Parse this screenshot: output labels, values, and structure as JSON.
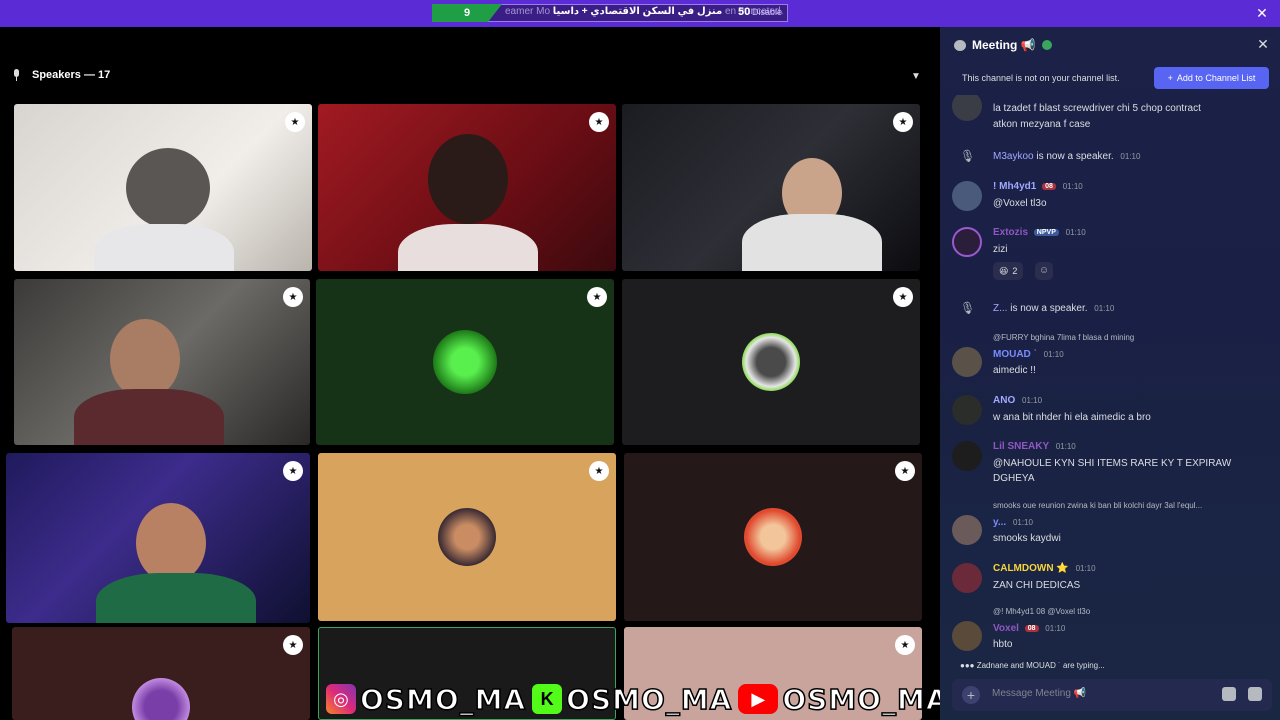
{
  "top_banner": {
    "left_number": "9",
    "text_fragment": "eamer Mo",
    "arabic_text": "منزل في السكن الاقتصادي + داسيا",
    "truncated_text": "en truncated.",
    "right_number": "50",
    "disable_fragment": "Disable"
  },
  "stage": {
    "header": "Speakers — 17"
  },
  "overlay": {
    "handle_instagram": "OSMO_MA",
    "handle_kick": "OSMO_MA",
    "handle_youtube": "OSMO_MA",
    "kick_letter": "K"
  },
  "panel": {
    "title": "Meeting 📢",
    "notice_text": "This channel is not on your channel list.",
    "add_button": "Add to Channel List",
    "messages": [
      {
        "name": "",
        "text": "la tzadet f blast screwdriver chi 5 chop contract",
        "text2": "atkon mezyana f case"
      },
      {
        "system_name": "M3aykoo",
        "system_text": "is now a speaker.",
        "time": "01:10"
      },
      {
        "name": "! Mh4yd1",
        "tag": "08",
        "time": "01:10",
        "text": "@Voxel tl3o"
      },
      {
        "name": "Extozis",
        "tag": "NPVP",
        "time": "01:10",
        "text": "zizi",
        "reaction_count": "2"
      },
      {
        "system_name": "Z...",
        "system_text": "is now a speaker.",
        "time": "01:10"
      },
      {
        "reply": "@FURRY bghina 7lima f blasa d mining",
        "name": "MOUAD ˙",
        "time": "01:10",
        "text": "aimedic !!"
      },
      {
        "name": "ANO",
        "time": "01:10",
        "text": "w ana bit nhder hi ela aimedic a bro"
      },
      {
        "name": "Lil SNEAKY",
        "time": "01:10",
        "text": "@NAHOULE KYN SHI ITEMS RARE KY T EXPIRAW",
        "text2": "DGHEYA"
      },
      {
        "reply": "smooks oue reunion zwina ki ban bli kolchi dayr 3al l'equl...",
        "name": "y...",
        "time": "01:10",
        "text": "smooks kaydwi"
      },
      {
        "name": "CALMDOWN ⭐",
        "time": "01:10",
        "text": "ZAN CHI DEDICAS"
      },
      {
        "reply": "@! Mh4yd1  08  @Voxel tl3o",
        "name": "Voxel",
        "tag": "08",
        "time": "01:10",
        "text": "hbto"
      }
    ],
    "typing": "Zadnane and MOUAD ˙ are typing...",
    "input_placeholder": "Message Meeting 📢"
  },
  "colors": {
    "accent": "#5865f2",
    "topbar": "#5b2bd6",
    "panel_bg": "#1b2147",
    "green": "#3ba55d"
  }
}
